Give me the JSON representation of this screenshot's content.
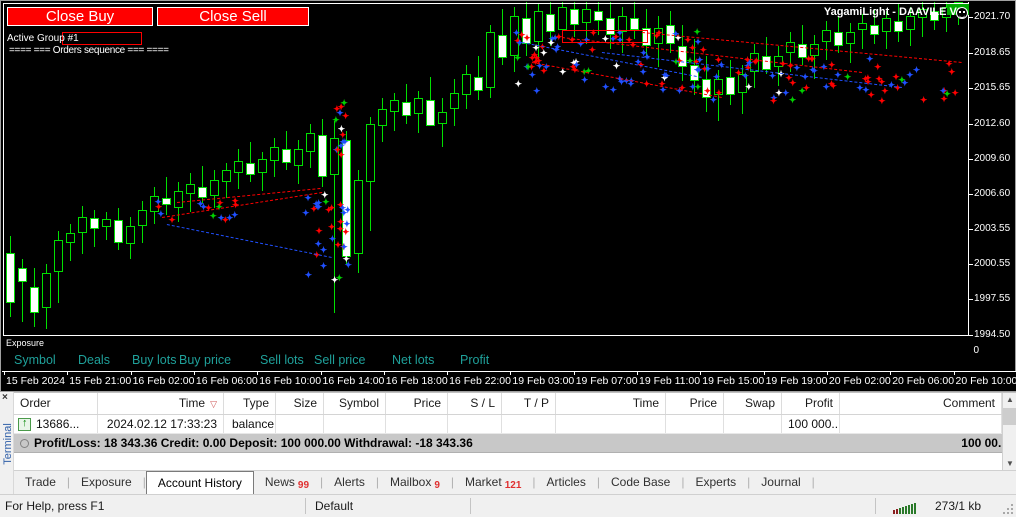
{
  "chart": {
    "title": "YagamiLight - DAAVILE V2",
    "close_buy_label": "Close Buy",
    "close_sell_label": "Close Sell",
    "active_group": "Active Group #1",
    "orders_sequence": "==== === Orders sequence === ====",
    "zero_label": "0",
    "price_labels": [
      "2021.70",
      "2018.65",
      "2015.65",
      "2012.60",
      "2009.60",
      "2006.60",
      "2003.55",
      "2000.55",
      "1997.55",
      "1994.50"
    ],
    "time_labels": [
      "15 Feb 2024",
      "15 Feb 21:00",
      "16 Feb 02:00",
      "16 Feb 06:00",
      "16 Feb 10:00",
      "16 Feb 14:00",
      "16 Feb 18:00",
      "16 Feb 22:00",
      "19 Feb 03:00",
      "19 Feb 07:00",
      "19 Feb 11:00",
      "19 Feb 15:00",
      "19 Feb 19:00",
      "20 Feb 02:00",
      "20 Feb 06:00",
      "20 Feb 10:00"
    ],
    "colors": {
      "background": "#000000",
      "bull_candle": "#00e000",
      "buy_marker": "#0040ff",
      "sell_marker": "#ff0000",
      "grid": "#ffffff",
      "button_red": "#ff0000"
    }
  },
  "exposure": {
    "caption": "Exposure",
    "columns": [
      "Symbol",
      "Deals",
      "Buy lots",
      "Buy price",
      "Sell lots",
      "Sell price",
      "Net lots",
      "Profit"
    ],
    "accent_color": "#1fa09a"
  },
  "terminal": {
    "sidebar_label": "Terminal",
    "close_icon": "×",
    "columns": [
      "Order",
      "Time",
      "Type",
      "Size",
      "Symbol",
      "Price",
      "S / L",
      "T / P",
      "Time",
      "Price",
      "Swap",
      "Profit",
      "Comment"
    ],
    "sort_indicator": "▽",
    "rows": [
      {
        "order": "13686...",
        "time": "2024.02.12 17:33:23",
        "type": "balance",
        "size": "",
        "symbol": "",
        "price": "",
        "sl": "",
        "tp": "",
        "time2": "",
        "price2": "",
        "swap": "",
        "profit": "100 000...",
        "comment": ""
      }
    ],
    "summary": {
      "profit_loss_label": "Profit/Loss:",
      "profit_loss_value": "18 343.36",
      "credit_label": "Credit:",
      "credit_value": "0.00",
      "deposit_label": "Deposit:",
      "deposit_value": "100 000.00",
      "withdrawal_label": "Withdrawal:",
      "withdrawal_value": "-18 343.36",
      "total": "100 00..."
    },
    "tabs": [
      {
        "label": "Trade",
        "badge": "",
        "active": false
      },
      {
        "label": "Exposure",
        "badge": "",
        "active": false
      },
      {
        "label": "Account History",
        "badge": "",
        "active": true
      },
      {
        "label": "News",
        "badge": "99",
        "active": false
      },
      {
        "label": "Alerts",
        "badge": "",
        "active": false
      },
      {
        "label": "Mailbox",
        "badge": "9",
        "active": false
      },
      {
        "label": "Market",
        "badge": "121",
        "active": false
      },
      {
        "label": "Articles",
        "badge": "",
        "active": false
      },
      {
        "label": "Code Base",
        "badge": "",
        "active": false
      },
      {
        "label": "Experts",
        "badge": "",
        "active": false
      },
      {
        "label": "Journal",
        "badge": "",
        "active": false
      }
    ]
  },
  "statusbar": {
    "help_text": "For Help, press F1",
    "profile": "Default",
    "network": "273/1 kb"
  },
  "chart_data": {
    "type": "candlestick",
    "title": "YagamiLight - DAAVILE V2",
    "xlabel": "",
    "ylabel": "",
    "ylim": [
      1994.5,
      2023.0
    ],
    "x_ticks": [
      "15 Feb 2024",
      "15 Feb 21:00",
      "16 Feb 02:00",
      "16 Feb 06:00",
      "16 Feb 10:00",
      "16 Feb 14:00",
      "16 Feb 18:00",
      "16 Feb 22:00",
      "19 Feb 03:00",
      "19 Feb 07:00",
      "19 Feb 11:00",
      "19 Feb 15:00",
      "19 Feb 19:00",
      "20 Feb 02:00",
      "20 Feb 06:00",
      "20 Feb 10:00"
    ],
    "y_ticks": [
      2021.7,
      2018.65,
      2015.65,
      2012.6,
      2009.6,
      2006.6,
      2003.55,
      2000.55,
      1997.55,
      1994.5
    ],
    "candles": [
      {
        "x": 8,
        "o": 2001.5,
        "h": 2003.0,
        "l": 1996.0,
        "c": 1997.2
      },
      {
        "x": 20,
        "o": 2000.2,
        "h": 2001.0,
        "l": 1995.6,
        "c": 1999.0
      },
      {
        "x": 32,
        "o": 1998.6,
        "h": 2000.2,
        "l": 1995.2,
        "c": 1996.4
      },
      {
        "x": 44,
        "o": 1996.8,
        "h": 2000.6,
        "l": 1995.0,
        "c": 1999.8
      },
      {
        "x": 56,
        "o": 1999.9,
        "h": 2003.4,
        "l": 1997.2,
        "c": 2002.6
      },
      {
        "x": 68,
        "o": 2002.4,
        "h": 2004.0,
        "l": 2000.8,
        "c": 2003.2
      },
      {
        "x": 80,
        "o": 2003.2,
        "h": 2005.5,
        "l": 2001.4,
        "c": 2004.6
      },
      {
        "x": 92,
        "o": 2004.5,
        "h": 2005.2,
        "l": 2002.0,
        "c": 2003.6
      },
      {
        "x": 104,
        "o": 2003.7,
        "h": 2005.0,
        "l": 2002.6,
        "c": 2004.4
      },
      {
        "x": 116,
        "o": 2004.3,
        "h": 2005.4,
        "l": 2001.8,
        "c": 2002.4
      },
      {
        "x": 128,
        "o": 2002.3,
        "h": 2004.6,
        "l": 2001.0,
        "c": 2003.8
      },
      {
        "x": 140,
        "o": 2003.8,
        "h": 2006.0,
        "l": 2002.4,
        "c": 2005.2
      },
      {
        "x": 152,
        "o": 2005.0,
        "h": 2007.2,
        "l": 2004.0,
        "c": 2006.4
      },
      {
        "x": 164,
        "o": 2006.2,
        "h": 2008.0,
        "l": 2004.8,
        "c": 2005.6
      },
      {
        "x": 176,
        "o": 2005.4,
        "h": 2007.6,
        "l": 2004.2,
        "c": 2006.8
      },
      {
        "x": 188,
        "o": 2006.6,
        "h": 2008.4,
        "l": 2005.0,
        "c": 2007.4
      },
      {
        "x": 200,
        "o": 2007.2,
        "h": 2009.0,
        "l": 2005.8,
        "c": 2006.2
      },
      {
        "x": 212,
        "o": 2006.4,
        "h": 2008.6,
        "l": 2005.4,
        "c": 2007.8
      },
      {
        "x": 224,
        "o": 2007.6,
        "h": 2009.2,
        "l": 2006.2,
        "c": 2008.6
      },
      {
        "x": 236,
        "o": 2008.4,
        "h": 2010.4,
        "l": 2007.0,
        "c": 2009.4
      },
      {
        "x": 248,
        "o": 2009.2,
        "h": 2011.0,
        "l": 2007.6,
        "c": 2008.2
      },
      {
        "x": 260,
        "o": 2008.4,
        "h": 2010.2,
        "l": 2006.8,
        "c": 2009.6
      },
      {
        "x": 272,
        "o": 2009.4,
        "h": 2011.4,
        "l": 2008.0,
        "c": 2010.6
      },
      {
        "x": 284,
        "o": 2010.4,
        "h": 2012.0,
        "l": 2008.6,
        "c": 2009.2
      },
      {
        "x": 296,
        "o": 2009.0,
        "h": 2011.2,
        "l": 2007.4,
        "c": 2010.4
      },
      {
        "x": 308,
        "o": 2010.2,
        "h": 2012.6,
        "l": 2008.8,
        "c": 2011.8
      },
      {
        "x": 320,
        "o": 2011.6,
        "h": 2013.0,
        "l": 2007.2,
        "c": 2008.0
      },
      {
        "x": 332,
        "o": 2008.2,
        "h": 2012.8,
        "l": 1996.4,
        "c": 2011.4
      },
      {
        "x": 344,
        "o": 2011.2,
        "h": 2012.0,
        "l": 2000.6,
        "c": 2001.2
      },
      {
        "x": 356,
        "o": 2001.4,
        "h": 2008.6,
        "l": 1999.8,
        "c": 2007.8
      },
      {
        "x": 368,
        "o": 2007.6,
        "h": 2013.2,
        "l": 2003.4,
        "c": 2012.6
      },
      {
        "x": 380,
        "o": 2012.4,
        "h": 2014.8,
        "l": 2011.0,
        "c": 2013.8
      },
      {
        "x": 392,
        "o": 2013.6,
        "h": 2015.2,
        "l": 2012.0,
        "c": 2014.6
      },
      {
        "x": 404,
        "o": 2014.4,
        "h": 2016.0,
        "l": 2012.6,
        "c": 2013.2
      },
      {
        "x": 416,
        "o": 2013.4,
        "h": 2015.4,
        "l": 2011.8,
        "c": 2014.8
      },
      {
        "x": 428,
        "o": 2014.6,
        "h": 2016.6,
        "l": 2013.2,
        "c": 2012.4
      },
      {
        "x": 440,
        "o": 2012.6,
        "h": 2014.8,
        "l": 2010.6,
        "c": 2013.6
      },
      {
        "x": 452,
        "o": 2013.8,
        "h": 2016.4,
        "l": 2012.4,
        "c": 2015.2
      },
      {
        "x": 464,
        "o": 2015.0,
        "h": 2017.6,
        "l": 2013.8,
        "c": 2016.8
      },
      {
        "x": 476,
        "o": 2016.6,
        "h": 2018.4,
        "l": 2014.6,
        "c": 2015.4
      },
      {
        "x": 488,
        "o": 2015.6,
        "h": 2021.0,
        "l": 2014.8,
        "c": 2020.4
      },
      {
        "x": 500,
        "o": 2020.2,
        "h": 2022.4,
        "l": 2017.6,
        "c": 2018.2
      },
      {
        "x": 512,
        "o": 2018.4,
        "h": 2022.6,
        "l": 2017.0,
        "c": 2021.8
      },
      {
        "x": 524,
        "o": 2021.6,
        "h": 2023.0,
        "l": 2018.4,
        "c": 2019.4
      },
      {
        "x": 536,
        "o": 2019.6,
        "h": 2022.8,
        "l": 2018.0,
        "c": 2022.2
      },
      {
        "x": 548,
        "o": 2022.0,
        "h": 2023.2,
        "l": 2019.2,
        "c": 2020.4
      },
      {
        "x": 560,
        "o": 2020.6,
        "h": 2023.4,
        "l": 2019.6,
        "c": 2022.6
      },
      {
        "x": 572,
        "o": 2022.4,
        "h": 2023.6,
        "l": 2020.0,
        "c": 2021.0
      },
      {
        "x": 584,
        "o": 2021.2,
        "h": 2023.0,
        "l": 2019.4,
        "c": 2022.4
      },
      {
        "x": 596,
        "o": 2022.2,
        "h": 2023.4,
        "l": 2020.2,
        "c": 2021.4
      },
      {
        "x": 608,
        "o": 2021.6,
        "h": 2023.2,
        "l": 2019.0,
        "c": 2020.2
      },
      {
        "x": 620,
        "o": 2020.4,
        "h": 2022.6,
        "l": 2018.6,
        "c": 2021.8
      },
      {
        "x": 632,
        "o": 2021.6,
        "h": 2023.0,
        "l": 2019.8,
        "c": 2020.6
      },
      {
        "x": 644,
        "o": 2020.8,
        "h": 2022.4,
        "l": 2018.2,
        "c": 2019.2
      },
      {
        "x": 656,
        "o": 2019.4,
        "h": 2021.8,
        "l": 2017.4,
        "c": 2020.8
      },
      {
        "x": 668,
        "o": 2021.0,
        "h": 2022.2,
        "l": 2018.6,
        "c": 2019.4
      },
      {
        "x": 680,
        "o": 2019.2,
        "h": 2021.0,
        "l": 2016.2,
        "c": 2017.4
      },
      {
        "x": 692,
        "o": 2017.6,
        "h": 2019.8,
        "l": 2015.0,
        "c": 2016.2
      },
      {
        "x": 704,
        "o": 2016.4,
        "h": 2018.4,
        "l": 2013.6,
        "c": 2014.8
      },
      {
        "x": 716,
        "o": 2015.0,
        "h": 2017.2,
        "l": 2012.8,
        "c": 2016.4
      },
      {
        "x": 728,
        "o": 2016.6,
        "h": 2018.0,
        "l": 2014.2,
        "c": 2015.0
      },
      {
        "x": 740,
        "o": 2015.2,
        "h": 2017.6,
        "l": 2013.4,
        "c": 2016.8
      },
      {
        "x": 752,
        "o": 2017.0,
        "h": 2019.4,
        "l": 2015.6,
        "c": 2018.6
      },
      {
        "x": 764,
        "o": 2018.4,
        "h": 2020.0,
        "l": 2016.8,
        "c": 2017.2
      },
      {
        "x": 776,
        "o": 2017.4,
        "h": 2019.2,
        "l": 2015.8,
        "c": 2018.4
      },
      {
        "x": 788,
        "o": 2018.6,
        "h": 2020.4,
        "l": 2017.0,
        "c": 2019.6
      },
      {
        "x": 800,
        "o": 2019.4,
        "h": 2021.0,
        "l": 2017.6,
        "c": 2018.2
      },
      {
        "x": 812,
        "o": 2018.4,
        "h": 2020.2,
        "l": 2016.4,
        "c": 2019.4
      },
      {
        "x": 824,
        "o": 2019.6,
        "h": 2021.4,
        "l": 2018.0,
        "c": 2020.6
      },
      {
        "x": 836,
        "o": 2020.4,
        "h": 2021.8,
        "l": 2018.6,
        "c": 2019.2
      },
      {
        "x": 848,
        "o": 2019.4,
        "h": 2021.2,
        "l": 2017.8,
        "c": 2020.4
      },
      {
        "x": 860,
        "o": 2020.6,
        "h": 2022.0,
        "l": 2019.0,
        "c": 2021.2
      },
      {
        "x": 872,
        "o": 2021.0,
        "h": 2022.4,
        "l": 2019.4,
        "c": 2020.2
      },
      {
        "x": 884,
        "o": 2020.4,
        "h": 2022.2,
        "l": 2019.0,
        "c": 2021.6
      },
      {
        "x": 896,
        "o": 2021.4,
        "h": 2022.8,
        "l": 2019.6,
        "c": 2020.4
      },
      {
        "x": 908,
        "o": 2020.6,
        "h": 2022.6,
        "l": 2019.2,
        "c": 2021.8
      },
      {
        "x": 920,
        "o": 2021.6,
        "h": 2023.0,
        "l": 2020.0,
        "c": 2022.4
      },
      {
        "x": 932,
        "o": 2022.2,
        "h": 2023.4,
        "l": 2020.6,
        "c": 2021.4
      },
      {
        "x": 944,
        "o": 2021.6,
        "h": 2023.2,
        "l": 2020.4,
        "c": 2022.6
      },
      {
        "x": 956,
        "o": 2022.4,
        "h": 2023.6,
        "l": 2021.0,
        "c": 2023.0
      }
    ]
  }
}
